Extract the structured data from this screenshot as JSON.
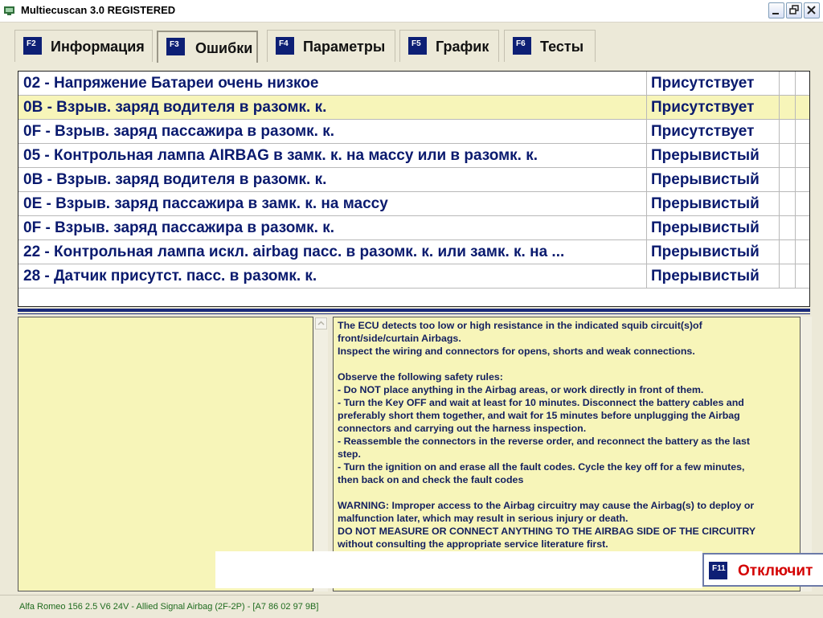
{
  "window": {
    "title": "Multiecuscan 3.0 REGISTERED"
  },
  "tabs": [
    {
      "key": "F2",
      "label": "Информация",
      "active": false
    },
    {
      "key": "F3",
      "label": "Ошибки",
      "active": true
    },
    {
      "key": "F4",
      "label": "Параметры",
      "active": false
    },
    {
      "key": "F5",
      "label": "График",
      "active": false
    },
    {
      "key": "F6",
      "label": "Тесты",
      "active": false
    }
  ],
  "faults": [
    {
      "description": "02 - Напряжение Батареи очень низкое",
      "status": "Присутствует",
      "selected": false
    },
    {
      "description": "0B - Взрыв. заряд водителя в разомк. к.",
      "status": "Присутствует",
      "selected": true
    },
    {
      "description": "0F - Взрыв. заряд пассажира в разомк. к.",
      "status": "Присутствует",
      "selected": false
    },
    {
      "description": "05 - Контрольная лампа AIRBAG в замк. к. на массу или в разомк. к.",
      "status": "Прерывистый",
      "selected": false
    },
    {
      "description": "0B - Взрыв. заряд водителя в разомк. к.",
      "status": "Прерывистый",
      "selected": false
    },
    {
      "description": "0E - Взрыв. заряд пассажира в замк. к. на массу",
      "status": "Прерывистый",
      "selected": false
    },
    {
      "description": "0F - Взрыв. заряд пассажира в разомк. к.",
      "status": "Прерывистый",
      "selected": false
    },
    {
      "description": "22 - Контрольная лампа искл. airbag пасс. в разомк. к. или замк. к. на ...",
      "status": "Прерывистый",
      "selected": false
    },
    {
      "description": "28 - Датчик присутст. пасс. в разомк. к.",
      "status": "Прерывистый",
      "selected": false
    }
  ],
  "info_text": "The ECU detects too low or high resistance in the indicated squib circuit(s)of\nfront/side/curtain Airbags.\nInspect the wiring and connectors for opens, shorts and weak connections.\n\nObserve the following safety rules:\n- Do NOT place anything in the Airbag areas, or work directly in front of them.\n- Turn the Key OFF and wait at least for 10 minutes. Disconnect the battery cables and\npreferably short them together, and wait for 15 minutes before unplugging the Airbag\nconnectors and carrying out the harness inspection.\n- Reassemble the connectors in the reverse order, and reconnect the battery as the last\nstep.\n- Turn the ignition on and erase all the fault codes. Cycle the key off for a few minutes,\nthen back on and check the fault codes\n\nWARNING: Improper access to the Airbag circuitry may cause the Airbag(s) to deploy or\nmalfunction later, which may result in serious injury or death.\nDO NOT MEASURE OR CONNECT ANYTHING TO THE AIRBAG SIDE OF THE CIRCUITRY\nwithout consulting the appropriate service literature first.",
  "disconnect": {
    "key": "F11",
    "label": "Отключит"
  },
  "status_bar": "Alfa Romeo 156 2.5 V6 24V - Allied Signal Airbag (2F-2P) - [A7 86 02 97 9B]",
  "colors": {
    "selected_row": "#f7f5b9",
    "fault_text": "#0a1a6e",
    "fkey_bg": "#0d1f75",
    "disconnect_text": "#d40000",
    "status_text": "#1e6b1e"
  }
}
